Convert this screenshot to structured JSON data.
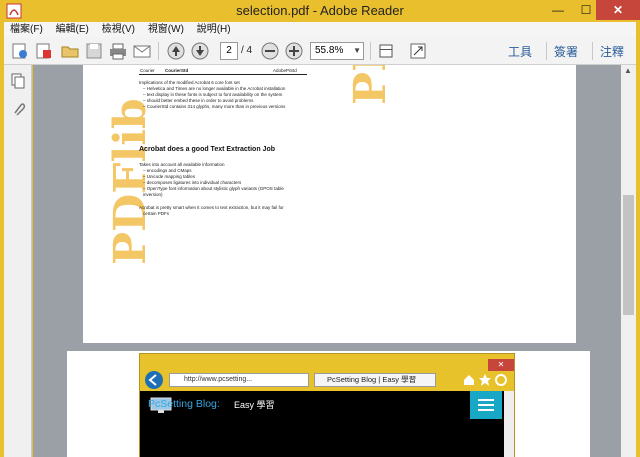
{
  "window": {
    "title": "selection.pdf - Adobe Reader",
    "min": "—",
    "max": "☐",
    "close": "✕"
  },
  "menu": [
    "檔案(F)",
    "編輯(E)",
    "檢視(V)",
    "視窗(W)",
    "說明(H)"
  ],
  "toolbar": {
    "page_current": "2",
    "page_total": "/ 4",
    "zoom": "55.8%",
    "tools_label": "工具",
    "sign_label": "簽署",
    "comment_label": "注釋"
  },
  "pdf": {
    "table_row": [
      "Courier",
      "CourierStd",
      "",
      "AdobePiStd"
    ],
    "bullets_top": [
      "Implications of the modified Acrobat 6 core font set",
      "– Helvetica and Times are no longer available in the Acrobat installation",
      "– text display in these fonts is subject to font availability on the system",
      "– should better embed these in order to avoid problems",
      "– CourierStd contains 314 glyphs, many more than in previous versions"
    ],
    "heading": "Acrobat does a good Text Extraction Job",
    "bullets_bottom": [
      "Takes into account all available information",
      "– encodings and CMaps",
      "– Unicode mapping tables",
      "– decomposes ligatures into individual characters",
      "– OpenType font information about stylistic glyph variants (GPOS table",
      "   inversion)",
      "",
      "Acrobat is pretty smart when it comes to text extraction, but it may fail for",
      "   certain PDFs"
    ],
    "watermark": "PDFlib"
  },
  "browser": {
    "url": "http://www.pcsetting...",
    "tab_title": "PcSetting Blog | Easy 學習",
    "blog_title": "PcSetting Blog:",
    "blog_sub": "Easy 學習"
  }
}
